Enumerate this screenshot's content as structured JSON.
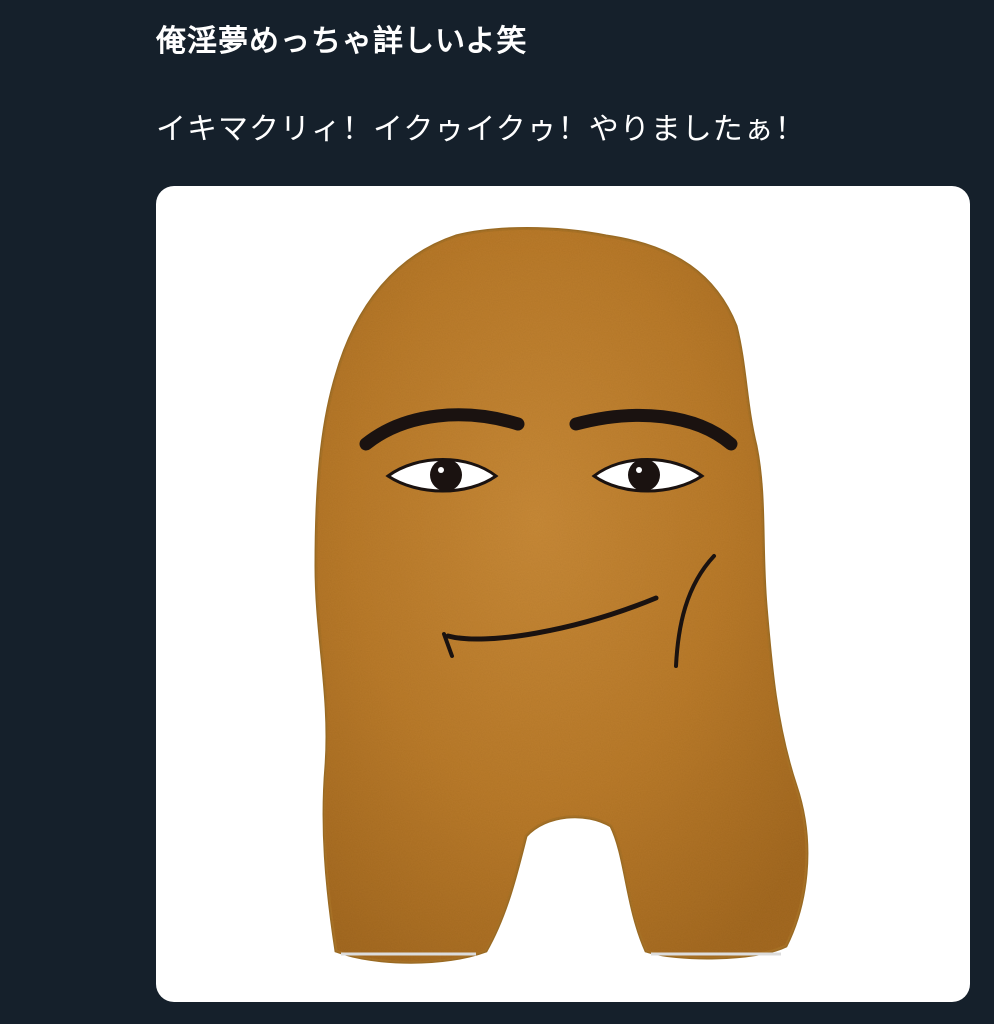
{
  "tweet": {
    "line1": "俺淫夢めっちゃ詳しいよ笑",
    "line2": "イキマクリィ！イクゥイクゥ！やりましたぁ！"
  },
  "media": {
    "image_icon": "nugget-face-image",
    "background_color": "#ffffff",
    "nugget_color": "#b97a2a",
    "nugget_dark": "#8a5516",
    "nugget_light": "#d89a47"
  },
  "theme": {
    "background": "#15202b",
    "text_color": "#ffffff"
  }
}
